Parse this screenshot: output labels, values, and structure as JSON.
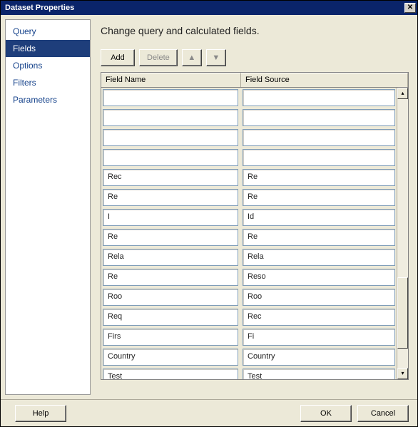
{
  "window": {
    "title": "Dataset Properties"
  },
  "sidebar": {
    "items": [
      {
        "label": "Query",
        "selected": false
      },
      {
        "label": "Fields",
        "selected": true
      },
      {
        "label": "Options",
        "selected": false
      },
      {
        "label": "Filters",
        "selected": false
      },
      {
        "label": "Parameters",
        "selected": false
      }
    ]
  },
  "main": {
    "heading": "Change query and calculated fields.",
    "toolbar": {
      "add": "Add",
      "delete": "Delete",
      "up_icon": "▲",
      "down_icon": "▼"
    },
    "grid": {
      "columns": {
        "name": "Field Name",
        "source": "Field Source"
      },
      "rows": [
        {
          "name": "",
          "source": ""
        },
        {
          "name": "",
          "source": ""
        },
        {
          "name": "",
          "source": ""
        },
        {
          "name": "",
          "source": ""
        },
        {
          "name": "Rec",
          "source": "Re"
        },
        {
          "name": "Re",
          "source": "Re"
        },
        {
          "name": "I",
          "source": "Id"
        },
        {
          "name": "Re",
          "source": "Re"
        },
        {
          "name": "Rela",
          "source": "Rela"
        },
        {
          "name": "Re",
          "source": "Reso"
        },
        {
          "name": "Roo",
          "source": "Roo"
        },
        {
          "name": "Req",
          "source": "Rec"
        },
        {
          "name": "Firs",
          "source": "Fi"
        },
        {
          "name": "Country",
          "source": "Country"
        },
        {
          "name": "Test",
          "source": "Test"
        }
      ]
    }
  },
  "footer": {
    "help": "Help",
    "ok": "OK",
    "cancel": "Cancel"
  }
}
